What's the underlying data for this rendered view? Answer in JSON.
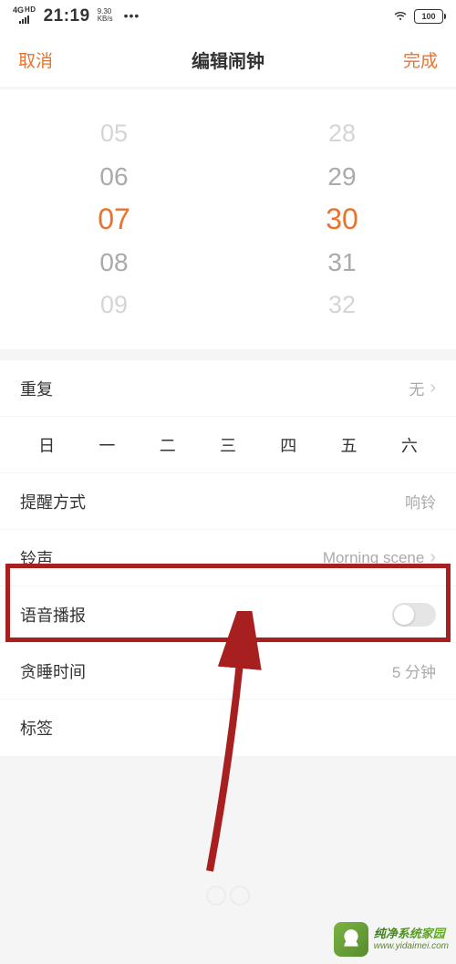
{
  "status": {
    "net": "4G",
    "hd": "HD",
    "time": "21:19",
    "speed_val": "9.30",
    "speed_unit": "KB/s",
    "dots": "•••",
    "battery": "100"
  },
  "header": {
    "cancel": "取消",
    "title": "编辑闹钟",
    "done": "完成"
  },
  "picker": {
    "hours": [
      "05",
      "06",
      "07",
      "08",
      "09"
    ],
    "mins": [
      "28",
      "29",
      "30",
      "31",
      "32"
    ],
    "selected_index": 2
  },
  "settings": {
    "repeat": {
      "label": "重复",
      "value": "无"
    },
    "days": [
      "日",
      "一",
      "二",
      "三",
      "四",
      "五",
      "六"
    ],
    "alert": {
      "label": "提醒方式",
      "value": "响铃"
    },
    "ringtone": {
      "label": "铃声",
      "value": "Morning scene"
    },
    "voice": {
      "label": "语音播报"
    },
    "snooze": {
      "label": "贪睡时间",
      "value": "5 分钟"
    },
    "tag": {
      "label": "标签"
    }
  },
  "watermark": {
    "title": "纯净系统家园",
    "url": "www.yidaimei.com"
  }
}
